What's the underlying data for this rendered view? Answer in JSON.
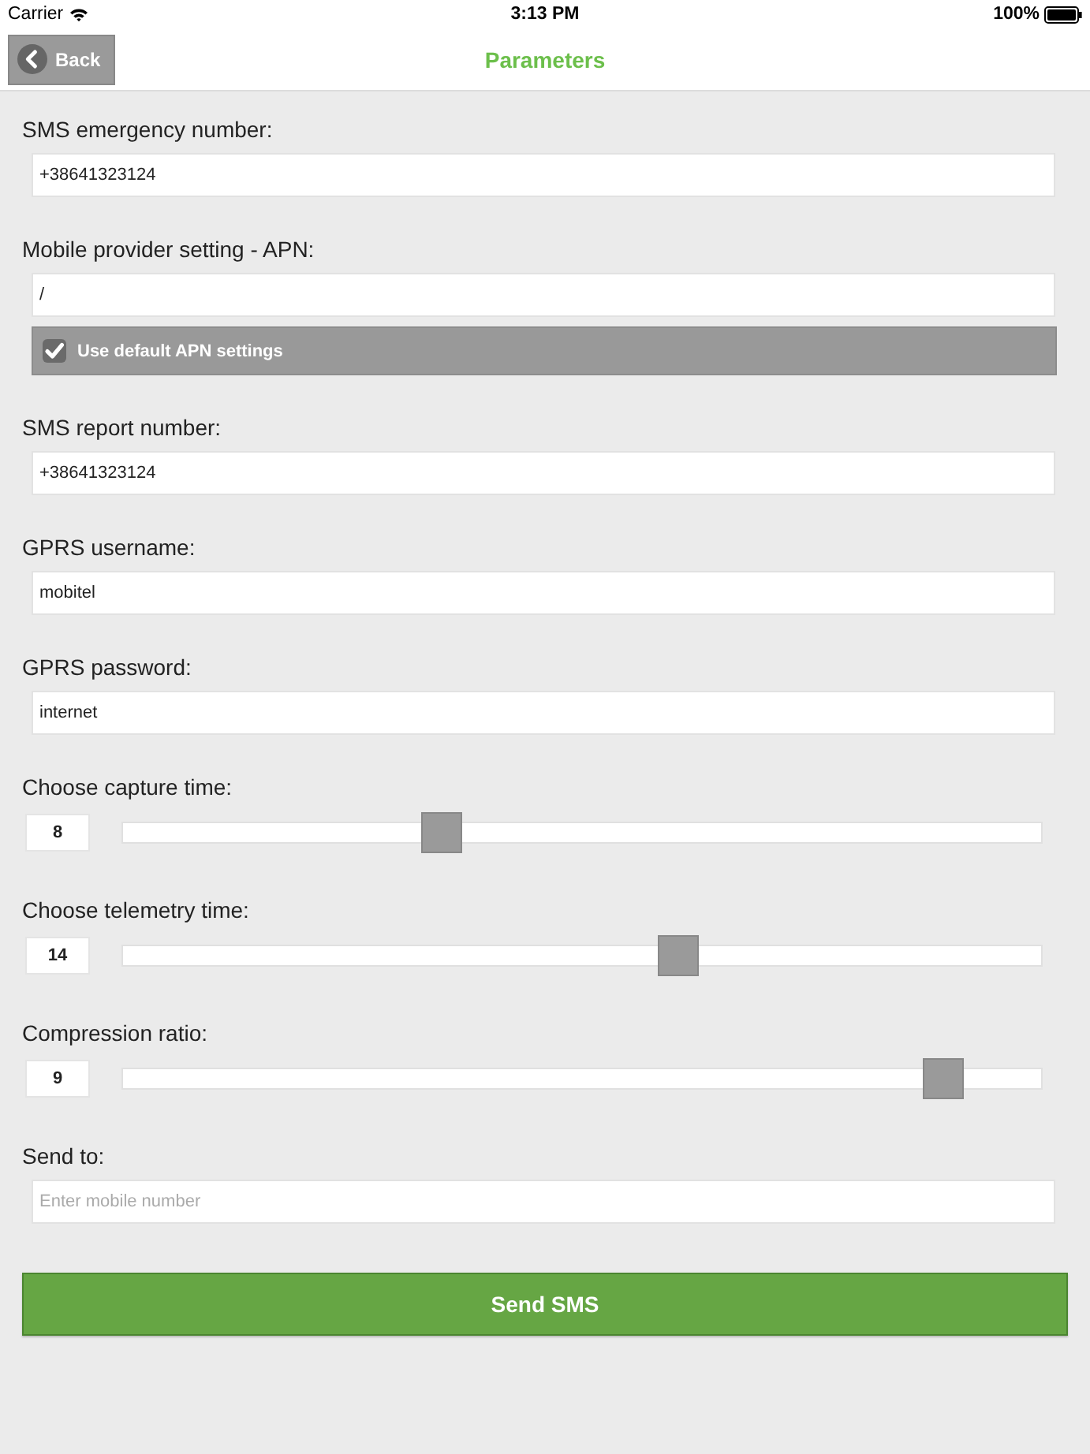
{
  "status_bar": {
    "carrier": "Carrier",
    "time": "3:13 PM",
    "battery": "100%"
  },
  "nav_bar": {
    "back_button": "Back",
    "title": "Parameters"
  },
  "form": [
    {
      "kind": "text",
      "label": "SMS emergency number:",
      "value": "+38641323124"
    },
    {
      "kind": "text",
      "label": "Mobile provider setting - APN:",
      "value": "/",
      "checkbox": {
        "label": "Use default APN settings",
        "checked": true
      }
    },
    {
      "kind": "text",
      "label": "SMS report number:",
      "value": "+38641323124"
    },
    {
      "kind": "text",
      "label": "GPRS username:",
      "value": "mobitel"
    },
    {
      "kind": "text",
      "label": "GPRS password:",
      "value": "internet"
    },
    {
      "kind": "slider",
      "label": "Choose capture time:",
      "reading": "8",
      "level": 0.34
    },
    {
      "kind": "slider",
      "label": "Choose telemetry time:",
      "reading": "14",
      "level": 0.61
    },
    {
      "kind": "slider",
      "label": "Compression ratio:",
      "reading": "9",
      "level": 0.91
    },
    {
      "kind": "text",
      "label": "Send to:",
      "placeholder": "Enter mobile number"
    }
  ],
  "send_button": "Send SMS"
}
